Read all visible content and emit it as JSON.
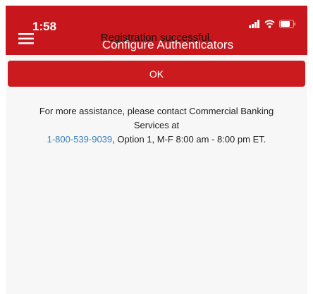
{
  "status_bar": {
    "time": "1:58",
    "icons": [
      "signal-icon",
      "wifi-icon",
      "battery-icon"
    ]
  },
  "header": {
    "title": "Configure Authenticators",
    "menu_icon": "hamburger-menu-icon",
    "background_color": "#c8171c"
  },
  "main": {
    "message": "Registration successful.",
    "ok_label": "OK",
    "help_text_1": "For more assistance, please contact Commercial Banking",
    "help_text_2": "Services at",
    "phone": "1-800-539-9039",
    "help_text_3": ", Option 1, M-F 8:00 am - 8:00 pm ET."
  },
  "colors": {
    "accent": "#cc1b1f",
    "link": "#3b7fb8",
    "content_bg": "#f7f7f7"
  }
}
